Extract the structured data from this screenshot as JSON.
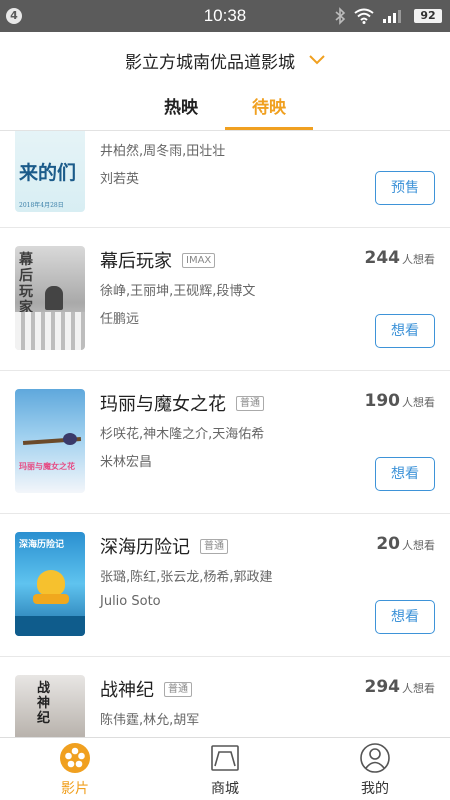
{
  "status_bar": {
    "notification_count": "4",
    "time": "10:38",
    "battery": "92",
    "icons": [
      "bluetooth-icon",
      "wifi-icon",
      "signal-icon",
      "battery-icon"
    ]
  },
  "header": {
    "location": "影立方城南优品道影城",
    "tabs": [
      {
        "label": "热映",
        "active": false
      },
      {
        "label": "待映",
        "active": true
      }
    ]
  },
  "colors": {
    "accent": "#f0a020",
    "button_blue": "#3e93d8",
    "status_bar": "#5b5b5b"
  },
  "movies": [
    {
      "poster_text": "来的们",
      "poster_date": "2018年4月28日",
      "cast": "井柏然,周冬雨,田壮壮",
      "director": "刘若英",
      "button": "预售"
    },
    {
      "title": "幕后玩家",
      "badge": "IMAX",
      "poster_text": "幕后玩家",
      "want_count": "244",
      "want_label": "人想看",
      "cast": "徐峥,王丽坤,王砚辉,段博文",
      "director": "任鹏远",
      "button": "想看"
    },
    {
      "title": "玛丽与魔女之花",
      "badge": "普通",
      "poster_text": "玛丽与魔女之花",
      "want_count": "190",
      "want_label": "人想看",
      "cast": "杉咲花,神木隆之介,天海佑希",
      "director": "米林宏昌",
      "button": "想看"
    },
    {
      "title": "深海历险记",
      "badge": "普通",
      "poster_text": "深海历险记",
      "want_count": "20",
      "want_label": "人想看",
      "cast": "张璐,陈红,张云龙,杨希,郭政建",
      "director": "Julio Soto",
      "button": "想看"
    },
    {
      "title": "战神纪",
      "badge": "普通",
      "poster_text": "战神纪",
      "want_count": "294",
      "want_label": "人想看",
      "cast": "陈伟霆,林允,胡军"
    }
  ],
  "bottom_nav": [
    {
      "label": "影片",
      "icon": "film-reel-icon",
      "active": true
    },
    {
      "label": "商城",
      "icon": "store-icon",
      "active": false
    },
    {
      "label": "我的",
      "icon": "profile-icon",
      "active": false
    }
  ]
}
